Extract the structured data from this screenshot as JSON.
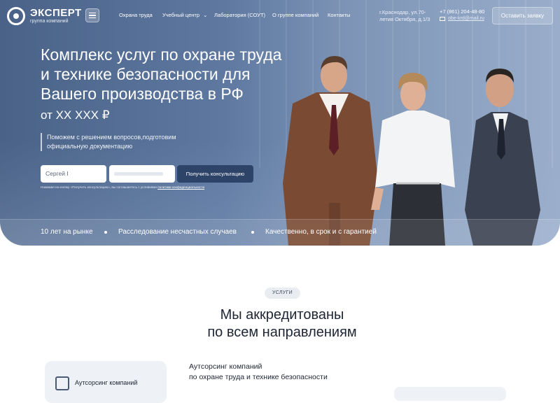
{
  "header": {
    "logo_name": "ЭКСПЕРТ",
    "logo_sub": "группа компаний",
    "nav": [
      "Охрана труда",
      "Учебный центр",
      "Лаборатория (СОУТ)",
      "О группе компаний",
      "Контакты"
    ],
    "address_line1": "г.Краснодар, ул.70-",
    "address_line2": "летия Октября, д.1/3",
    "phone": "+7 (861) 204-48-80",
    "email": "obe-krd@mail.ru",
    "request_button": "Оставить заявку"
  },
  "hero": {
    "title": "Комплекс услуг по охране труда и технике безопасности для Вашего производства в РФ",
    "price": "от XX XXX ₽",
    "description": "Поможем с решением вопросов,подготовим официальную документацию",
    "name_input_value": "Сергей I",
    "consult_button": "Получить консультацию",
    "legal_text": "Нажимая на кнопку «Получить консультацию», вы соглашаетесь с условиями",
    "legal_link": "политики конфиденциальности",
    "features": [
      "10 лет на рынке",
      "Расследование несчастных случаев",
      "Качественно, в срок и с гарантией"
    ]
  },
  "services": {
    "pill": "УСЛУГИ",
    "title_line1": "Мы аккредитованы",
    "title_line2": "по всем направлениям",
    "left_card_label": "Аутсорсинг компаний",
    "right_title_line1": "Аутсорсинг компаний",
    "right_title_line2": "по охране труда и технике безопасности"
  },
  "colors": {
    "hero_blue": "#5e78a0",
    "button_dark": "#2e4368",
    "text_dark": "#1e2533"
  }
}
